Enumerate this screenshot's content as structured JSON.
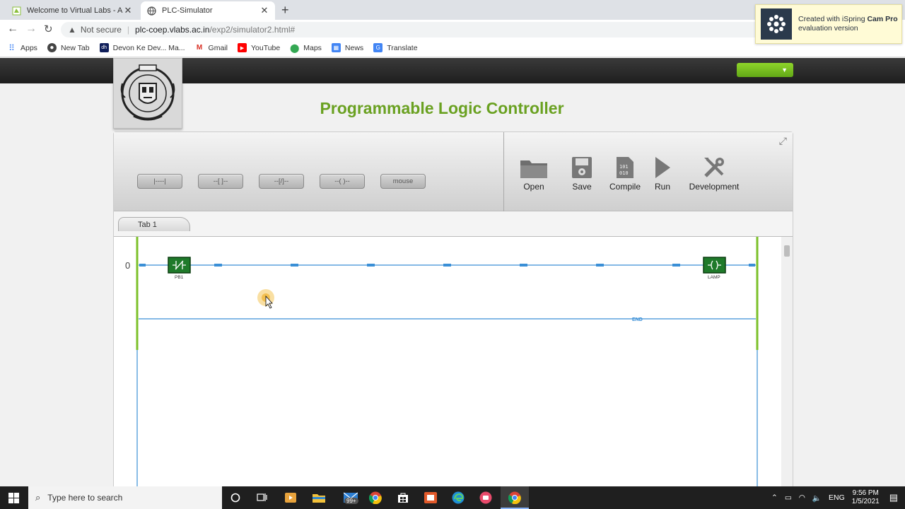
{
  "browser": {
    "tabs": [
      {
        "title": "Welcome to Virtual Labs - A MHR",
        "active": false
      },
      {
        "title": "PLC-Simulator",
        "active": true
      }
    ],
    "address": {
      "security": "Not secure",
      "host": "plc-coep.vlabs.ac.in",
      "path": "/exp2/simulator2.html#"
    },
    "bookmarks": [
      {
        "label": "Apps",
        "icon": "apps-grid-icon",
        "color": "#4285f4"
      },
      {
        "label": "New Tab",
        "icon": "globe-icon",
        "color": "#444444"
      },
      {
        "label": "Devon Ke Dev... Ma...",
        "icon": "hotstar-icon",
        "color": "#0f1e5a"
      },
      {
        "label": "Gmail",
        "icon": "gmail-icon",
        "color": "#d93025"
      },
      {
        "label": "YouTube",
        "icon": "youtube-icon",
        "color": "#ff0000"
      },
      {
        "label": "Maps",
        "icon": "maps-pin-icon",
        "color": "#34a853"
      },
      {
        "label": "News",
        "icon": "news-icon",
        "color": "#4285f4"
      },
      {
        "label": "Translate",
        "icon": "translate-icon",
        "color": "#4285f4"
      }
    ]
  },
  "watermark": {
    "line1": "Created with iSpring ",
    "bold": "Cam Pro",
    "line2": "evaluation version"
  },
  "page": {
    "title": "Programmable Logic Controller",
    "accent": "#6aa121"
  },
  "toolbar": {
    "elements": [
      "|----|",
      "--[ ]--",
      "--[/]--",
      "--( )--",
      "mouse"
    ],
    "actions": [
      "Open",
      "Save",
      "Compile",
      "Run",
      "Development"
    ]
  },
  "tabs": [
    "Tab 1"
  ],
  "ladder": {
    "rung_number": "0",
    "contact_label": "PB1",
    "coil_label": "LAMP",
    "end_label": "END",
    "rail_color": "#7cc12a",
    "wire_color": "#3a8fd6"
  },
  "taskbar": {
    "search_placeholder": "Type here to search",
    "mail_badge": "99+",
    "language": "ENG",
    "time": "9:56 PM",
    "date": "1/5/2021"
  }
}
